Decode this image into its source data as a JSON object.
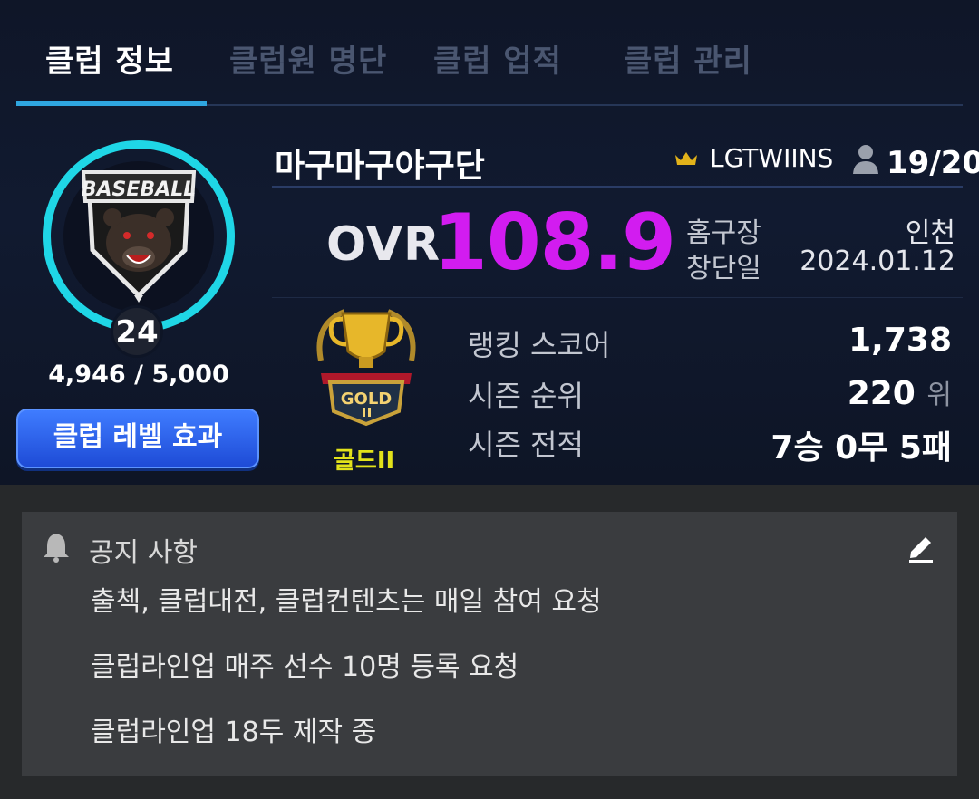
{
  "tabs": [
    {
      "label": "클럽 정보",
      "active": true
    },
    {
      "label": "클럽원 명단",
      "active": false
    },
    {
      "label": "클럽 업적",
      "active": false
    },
    {
      "label": "클럽 관리",
      "active": false
    }
  ],
  "club": {
    "emblem_text": "BASEBALL",
    "level": "24",
    "exp": "4,946 / 5,000",
    "level_button": "클럽 레벨 효과",
    "name": "마구마구야구단",
    "leader": "LGTWIINS",
    "members": "19/20",
    "ovr_label": "OVR",
    "ovr_value": "108.9",
    "home_label": "홈구장",
    "home_value": "인천",
    "founded_label": "창단일",
    "founded_value": "2024.01.12",
    "tier_name": "골드II",
    "tier_badge_text": "GOLD",
    "stats": {
      "ranking_label": "랭킹 스코어",
      "ranking_value": "1,738",
      "season_rank_label": "시즌 순위",
      "season_rank_value": "220",
      "season_rank_unit": "위",
      "record_label": "시즌 전적",
      "record_value": "7승 0무 5패"
    }
  },
  "notice": {
    "title": "공지 사항",
    "lines": [
      "출첵, 클럽대전, 클럽컨텐츠는 매일 참여 요청",
      "클럽라인업 매주 선수 10명 등록 요청",
      "클럽라인업 18두 제작 중"
    ]
  },
  "colors": {
    "accent_tab": "#2fa6e0",
    "ring": "#1fd6e6",
    "ovr": "#d21cf0",
    "tier": "#e2e21a",
    "button": "#2a5ef0"
  },
  "icons": [
    "crown-icon",
    "person-icon",
    "bell-icon",
    "edit-icon"
  ]
}
